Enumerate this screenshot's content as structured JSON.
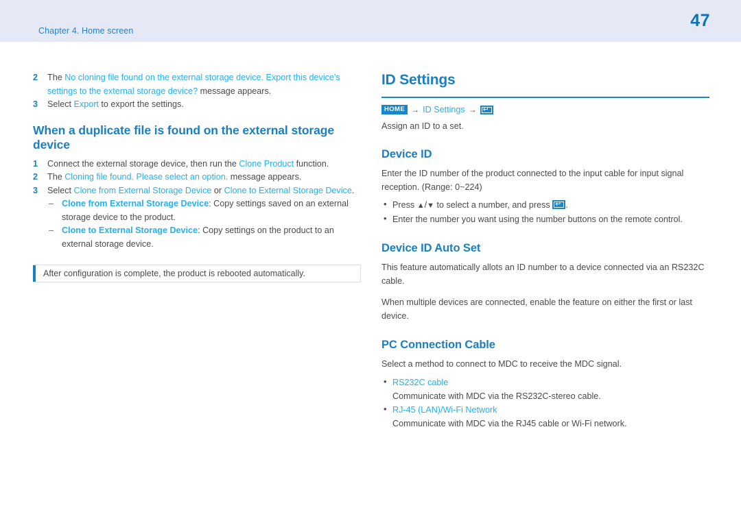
{
  "header": {
    "chapter": "Chapter 4. Home screen",
    "page_number": "47"
  },
  "left_column": {
    "continued_steps": [
      {
        "num": "2",
        "prefix": "The ",
        "highlight": "No cloning file found on the external storage device. Export this device's settings to the external storage device?",
        "suffix": " message appears."
      },
      {
        "num": "3",
        "prefix": "Select ",
        "highlight": "Export",
        "suffix": " to export the settings."
      }
    ],
    "heading": "When a duplicate file is found on the external storage device",
    "steps": [
      {
        "num": "1",
        "prefix": "Connect the external storage device, then run the ",
        "highlight": "Clone Product",
        "suffix": " function."
      },
      {
        "num": "2",
        "prefix": "The ",
        "highlight": "Cloning file found. Please select an option.",
        "suffix": " message appears."
      },
      {
        "num": "3",
        "prefix": "Select ",
        "highlight": "Clone from External Storage Device",
        "middle": " or ",
        "highlight2": "Clone to External Storage Device",
        "suffix": "."
      }
    ],
    "sub_items": [
      {
        "dash": "–",
        "term": "Clone from External Storage Device",
        "desc": ": Copy settings saved on an external storage device to the product."
      },
      {
        "dash": "–",
        "term": "Clone to External Storage Device",
        "desc": ": Copy settings on the product to an external storage device."
      }
    ],
    "note": "After configuration is complete, the product is rebooted automatically."
  },
  "right_column": {
    "title": "ID Settings",
    "breadcrumb": {
      "home_label": "HOME",
      "arrow1": "→",
      "path": "ID Settings",
      "arrow2": "→",
      "enter_icon": "enter-key-icon",
      "enter_glyph": "↵"
    },
    "intro": "Assign an ID to a set.",
    "sections": [
      {
        "heading": "Device ID",
        "paragraphs": [
          "Enter the ID number of the product connected to the input cable for input signal reception. (Range: 0~224)"
        ],
        "bullets": [
          {
            "pre": "Press ",
            "up": "▲",
            "slash": "/",
            "down": "▼",
            "post": " to select a number, and press ",
            "icon": "enter-key-icon",
            "end": "."
          },
          {
            "text": "Enter the number you want using the number buttons on the remote control."
          }
        ]
      },
      {
        "heading": "Device ID Auto Set",
        "paragraphs": [
          "This feature automatically allots an ID number to a device connected via an RS232C cable.",
          "When multiple devices are connected, enable the feature on either the first or last device."
        ]
      },
      {
        "heading": "PC Connection Cable",
        "paragraphs": [
          "Select a method to connect to MDC to receive the MDC signal."
        ],
        "option_bullets": [
          {
            "label": "RS232C cable",
            "desc": "Communicate with MDC via the RS232C-stereo cable."
          },
          {
            "label": "RJ-45 (LAN)/Wi-Fi Network",
            "desc": "Communicate with MDC via the RJ45 cable or Wi-Fi network."
          }
        ]
      }
    ]
  },
  "colors": {
    "header_band": "#e5e9f5",
    "heading_blue": "#1a7fc1",
    "link_blue": "#24b0ef",
    "body_gray": "#4a4a4a",
    "rule_blue": "#1a86c8"
  }
}
